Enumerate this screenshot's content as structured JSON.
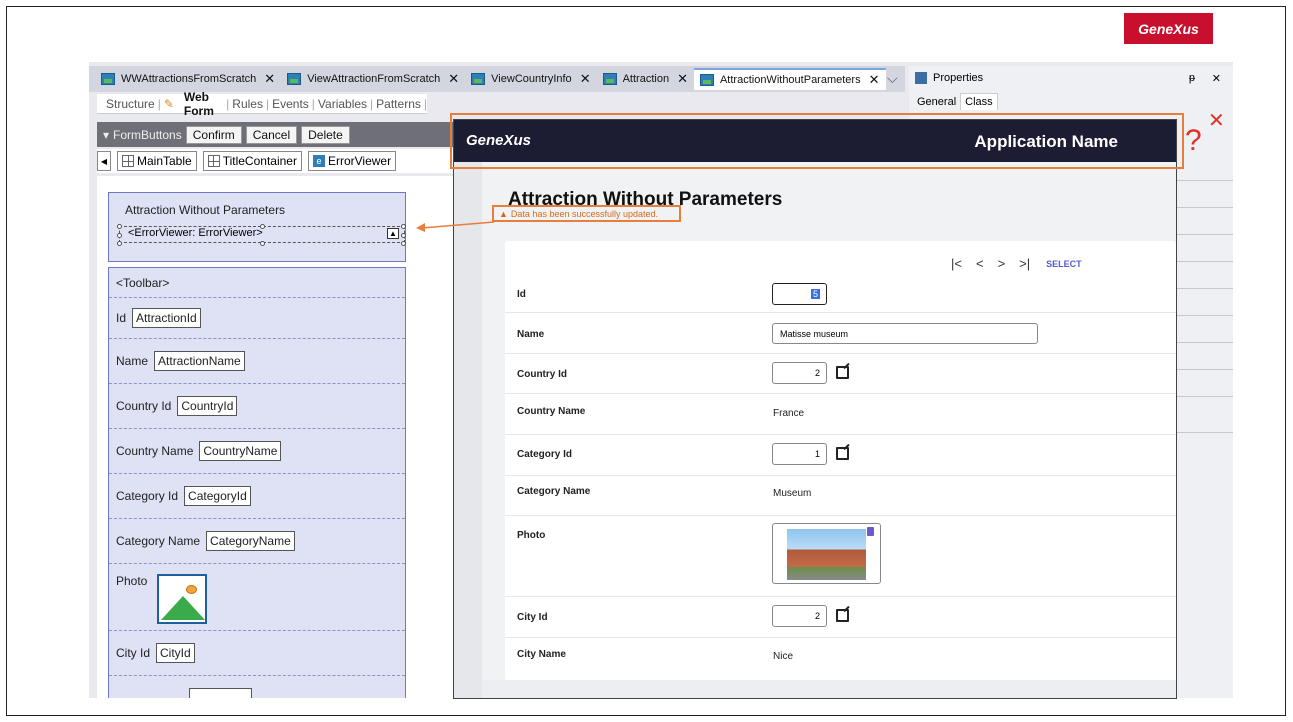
{
  "brand": {
    "logo": "GeneXus"
  },
  "ide": {
    "doc_tabs": [
      {
        "label": "WWAttractionsFromScratch"
      },
      {
        "label": "ViewAttractionFromScratch"
      },
      {
        "label": "ViewCountryInfo"
      },
      {
        "label": "Attraction"
      },
      {
        "label": "AttractionWithoutParameters"
      }
    ],
    "editor_tabs": [
      "Structure",
      "Web Form",
      "Rules",
      "Events",
      "Variables",
      "Patterns"
    ],
    "designer_toolbar": {
      "group_label": "FormButtons",
      "buttons": [
        "Confirm",
        "Cancel",
        "Delete"
      ]
    },
    "breadcrumb": [
      "MainTable",
      "TitleContainer",
      "ErrorViewer"
    ],
    "form": {
      "title": "Attraction Without Parameters",
      "error_viewer": "<ErrorViewer: ErrorViewer>",
      "toolbar": "<Toolbar>",
      "fields": [
        {
          "label": "Id",
          "control": "AttractionId"
        },
        {
          "label": "Name",
          "control": "AttractionName"
        },
        {
          "label": "Country Id",
          "control": "CountryId"
        },
        {
          "label": "Country Name",
          "control": "CountryName"
        },
        {
          "label": "Category Id",
          "control": "CategoryId"
        },
        {
          "label": "Category Name",
          "control": "CategoryName"
        },
        {
          "label": "Photo"
        },
        {
          "label": "City Id",
          "control": "CityId"
        }
      ]
    },
    "properties": {
      "title": "Properties",
      "tabs": [
        "General",
        "Class"
      ]
    }
  },
  "page": {
    "logo": "GeneXus",
    "app_name": "Application Name",
    "title": "Attraction Without Parameters",
    "message": "Data has been successfully updated.",
    "nav": {
      "select": "SELECT"
    },
    "rows": [
      {
        "label": "Id",
        "value": "5"
      },
      {
        "label": "Name",
        "value": "Matisse museum"
      },
      {
        "label": "Country Id",
        "value": "2"
      },
      {
        "label": "Country Name",
        "value": "France"
      },
      {
        "label": "Category Id",
        "value": "1"
      },
      {
        "label": "Category Name",
        "value": "Museum"
      },
      {
        "label": "Photo"
      },
      {
        "label": "City Id",
        "value": "2"
      },
      {
        "label": "City Name",
        "value": "Nice"
      }
    ]
  },
  "annotation": {
    "question": "?",
    "accent_color": "#e87e3b",
    "error_color": "#e0302a"
  },
  "colors": {
    "brand_red": "#c8102e",
    "app_header": "#1c1c33",
    "design_fill": "#dfe1f5",
    "message_orange": "#d9691a"
  }
}
